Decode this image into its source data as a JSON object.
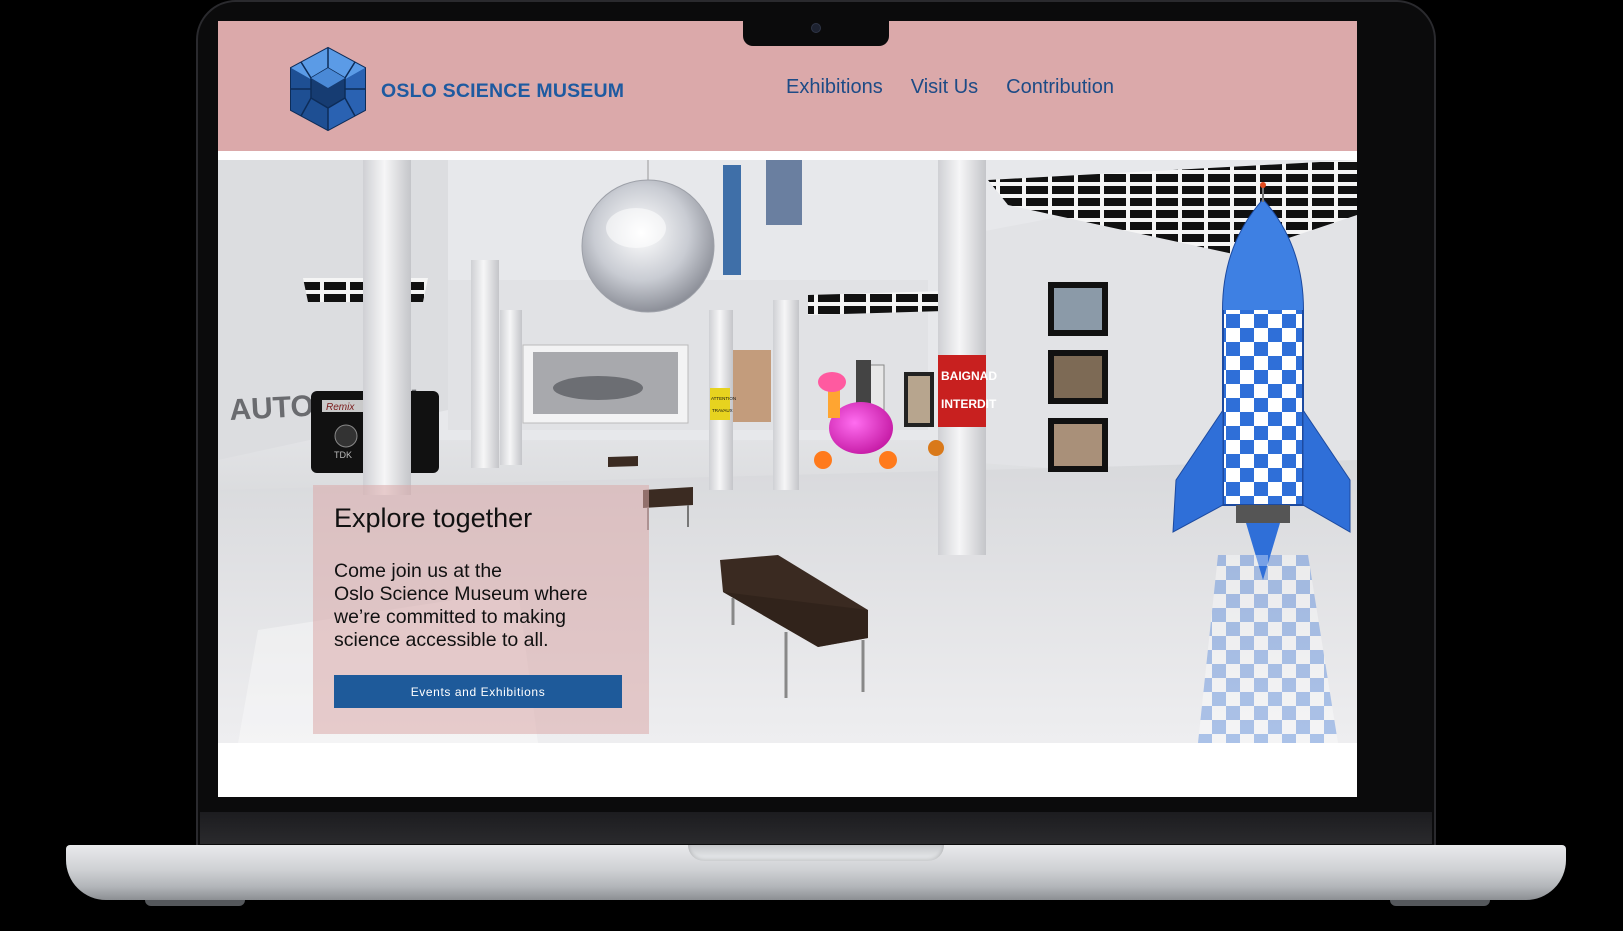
{
  "header": {
    "brand_name": "OSLO SCIENCE MUSEUM",
    "nav": [
      {
        "label": "Exhibitions"
      },
      {
        "label": "Visit Us"
      },
      {
        "label": "Contribution"
      }
    ]
  },
  "hero": {
    "image_description": "3D virtual museum gallery hall",
    "signs": {
      "wall_text": "AUTOMOBILI",
      "pillar_sign_line1": "BAIGNAD",
      "pillar_sign_line2": "INTERDIT",
      "cassette_label": "Remix",
      "cassette_brand": "TDK",
      "caution_sign_line1": "ATTENTION",
      "caution_sign_line2": "TRAVAUX"
    },
    "promo": {
      "title": "Explore together",
      "text_line1": "Come join us at the",
      "text_line2": "Oslo Science Museum where",
      "text_line3": "we’re committed to making",
      "text_line4": "science accessible to all.",
      "button_label": "Events and Exhibitions"
    }
  },
  "colors": {
    "header_bg": "#dba9aa",
    "brand": "#1e5aa0",
    "nav_text": "#1d4b86",
    "button_bg": "#1e5a9a",
    "rocket_blue": "#2f6fd8"
  }
}
